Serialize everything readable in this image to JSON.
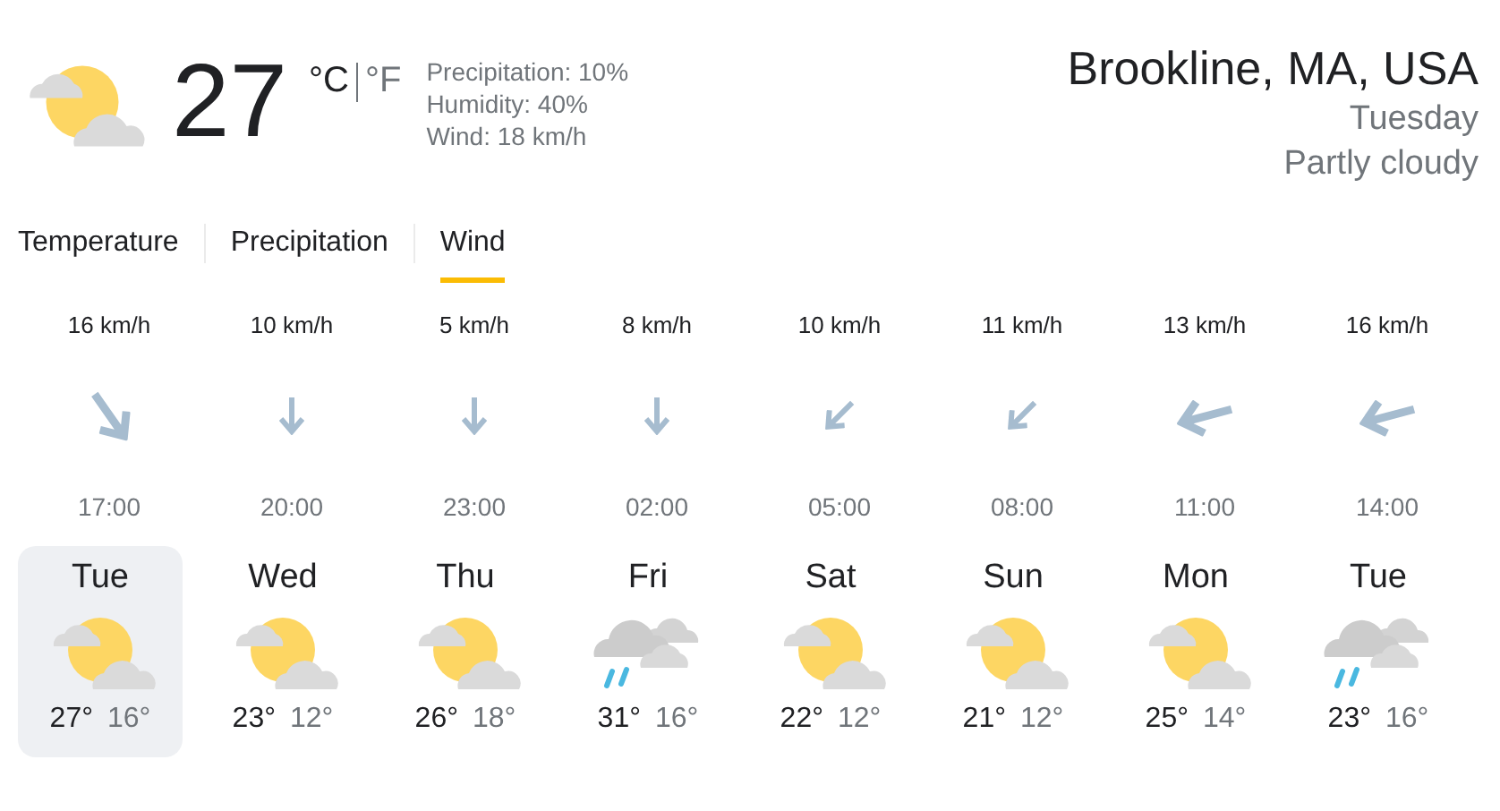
{
  "current": {
    "kind": "partly-cloudy",
    "temperature": "27",
    "units": [
      {
        "label": "°C",
        "selected": true
      },
      {
        "label": "°F",
        "selected": false
      }
    ],
    "details": [
      "Precipitation: 10%",
      "Humidity: 40%",
      "Wind: 18 km/h"
    ]
  },
  "location": {
    "place": "Brookline, MA, USA",
    "day": "Tuesday",
    "condition": "Partly cloudy"
  },
  "tabs": [
    {
      "label": "Temperature",
      "selected": false
    },
    {
      "label": "Precipitation",
      "selected": false
    },
    {
      "label": "Wind",
      "selected": true
    }
  ],
  "wind": [
    {
      "speed": "16 km/h",
      "kind": "southeast",
      "time": "17:00"
    },
    {
      "speed": "10 km/h",
      "kind": "south",
      "time": "20:00"
    },
    {
      "speed": "5 km/h",
      "kind": "south",
      "time": "23:00"
    },
    {
      "speed": "8 km/h",
      "kind": "south",
      "time": "02:00"
    },
    {
      "speed": "10 km/h",
      "kind": "southwest",
      "time": "05:00"
    },
    {
      "speed": "11 km/h",
      "kind": "southwest",
      "time": "08:00"
    },
    {
      "speed": "13 km/h",
      "kind": "west",
      "time": "11:00"
    },
    {
      "speed": "16 km/h",
      "kind": "west",
      "time": "14:00"
    }
  ],
  "days": [
    {
      "day": "Tue",
      "kind": "partly-cloudy",
      "high": "27°",
      "low": "16°",
      "selected": true
    },
    {
      "day": "Wed",
      "kind": "partly-cloudy",
      "high": "23°",
      "low": "12°",
      "selected": false
    },
    {
      "day": "Thu",
      "kind": "partly-cloudy",
      "high": "26°",
      "low": "18°",
      "selected": false
    },
    {
      "day": "Fri",
      "kind": "rain",
      "high": "31°",
      "low": "16°",
      "selected": false
    },
    {
      "day": "Sat",
      "kind": "partly-cloudy",
      "high": "22°",
      "low": "12°",
      "selected": false
    },
    {
      "day": "Sun",
      "kind": "partly-cloudy",
      "high": "21°",
      "low": "12°",
      "selected": false
    },
    {
      "day": "Mon",
      "kind": "partly-cloudy",
      "high": "25°",
      "low": "14°",
      "selected": false
    },
    {
      "day": "Tue",
      "kind": "rain",
      "high": "23°",
      "low": "16°",
      "selected": false
    }
  ]
}
